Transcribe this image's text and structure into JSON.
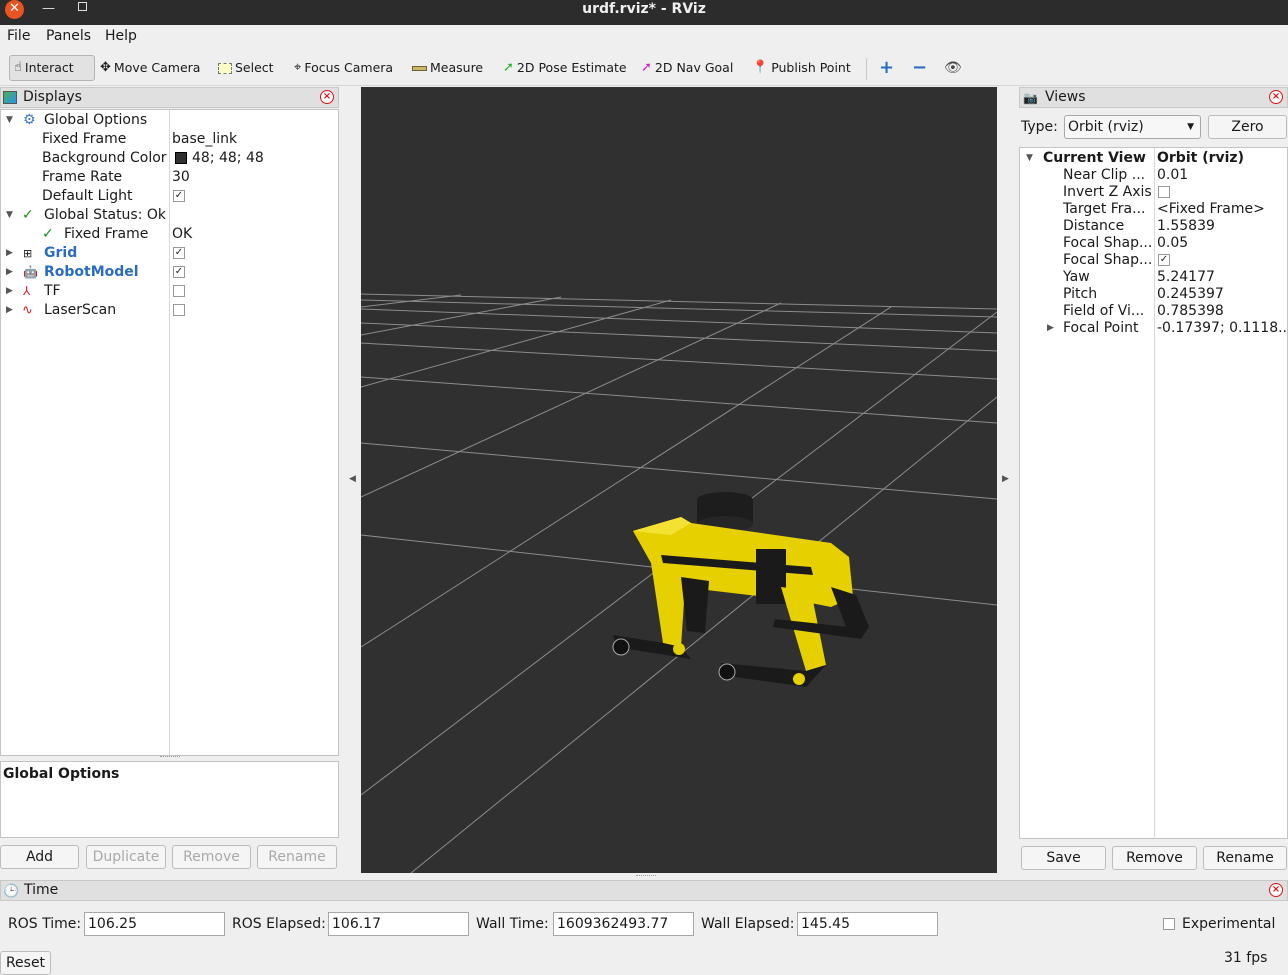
{
  "window": {
    "title": "urdf.rviz* - RViz"
  },
  "menu": [
    "File",
    "Panels",
    "Help"
  ],
  "toolbar": {
    "interact": "Interact",
    "move_camera": "Move Camera",
    "select": "Select",
    "focus_camera": "Focus Camera",
    "measure": "Measure",
    "pose_estimate": "2D Pose Estimate",
    "nav_goal": "2D Nav Goal",
    "publish_point": "Publish Point"
  },
  "displays": {
    "title": "Displays",
    "global_options": "Global Options",
    "fixed_frame_label": "Fixed Frame",
    "fixed_frame_value": "base_link",
    "bg_color_label": "Background Color",
    "bg_color_value": "48; 48; 48",
    "frame_rate_label": "Frame Rate",
    "frame_rate_value": "30",
    "default_light_label": "Default Light",
    "global_status": "Global Status: Ok",
    "status_fixed_frame": "Fixed Frame",
    "status_fixed_frame_value": "OK",
    "grid": "Grid",
    "robot_model": "RobotModel",
    "tf": "TF",
    "laser_scan": "LaserScan",
    "description_title": "Global Options",
    "buttons": {
      "add": "Add",
      "duplicate": "Duplicate",
      "remove": "Remove",
      "rename": "Rename"
    }
  },
  "views": {
    "title": "Views",
    "type_label": "Type:",
    "type_value": "Orbit (rviz)",
    "zero": "Zero",
    "current_view": "Current View",
    "current_view_value": "Orbit (rviz)",
    "props": [
      {
        "name": "Near Clip ...",
        "value": "0.01"
      },
      {
        "name": "Invert Z Axis",
        "value": ""
      },
      {
        "name": "Target Fra...",
        "value": "<Fixed Frame>"
      },
      {
        "name": "Distance",
        "value": "1.55839"
      },
      {
        "name": "Focal Shap...",
        "value": "0.05"
      },
      {
        "name": "Focal Shap...",
        "value": ""
      },
      {
        "name": "Yaw",
        "value": "5.24177"
      },
      {
        "name": "Pitch",
        "value": "0.245397"
      },
      {
        "name": "Field of Vi...",
        "value": "0.785398"
      },
      {
        "name": "Focal Point",
        "value": "-0.17397; 0.1118..."
      }
    ],
    "buttons": {
      "save": "Save",
      "remove": "Remove",
      "rename": "Rename"
    }
  },
  "time": {
    "title": "Time",
    "ros_time_label": "ROS Time:",
    "ros_time": "106.25",
    "ros_elapsed_label": "ROS Elapsed:",
    "ros_elapsed": "106.17",
    "wall_time_label": "Wall Time:",
    "wall_time": "1609362493.77",
    "wall_elapsed_label": "Wall Elapsed:",
    "wall_elapsed": "145.45",
    "experimental": "Experimental",
    "reset": "Reset",
    "fps": "31 fps"
  },
  "colors": {
    "viewport_bg": "#303030",
    "robot": "#e6d000",
    "accent": "#e95420"
  }
}
